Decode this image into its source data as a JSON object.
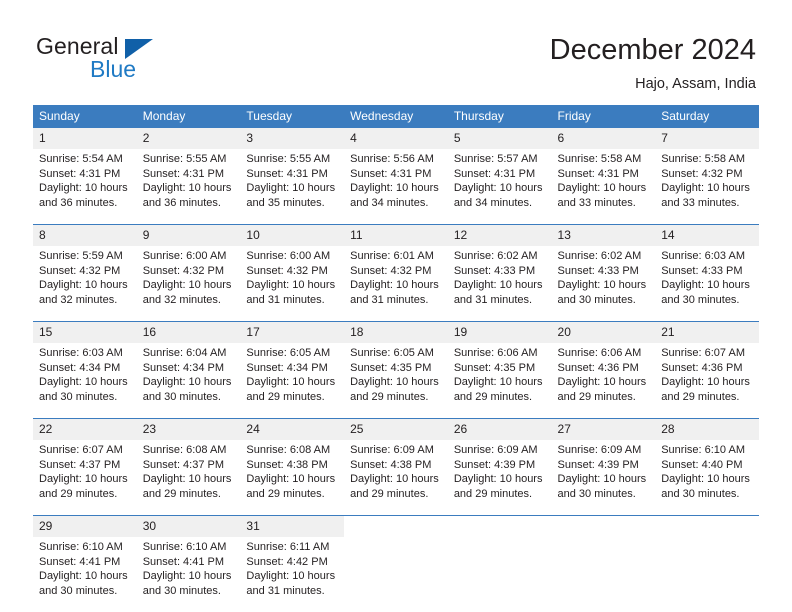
{
  "brand": {
    "name_part1": "General",
    "name_part2": "Blue",
    "triangle_icon": "triangle-icon",
    "accent_blue": "#1f7ac4",
    "logo_blue": "#1060a8"
  },
  "header": {
    "title": "December 2024",
    "subtitle": "Hajo, Assam, India"
  },
  "calendar": {
    "header_bg": "#3b7cbf",
    "header_text_color": "#ffffff",
    "daynum_bg": "#f0f0f0",
    "weekdays": [
      "Sunday",
      "Monday",
      "Tuesday",
      "Wednesday",
      "Thursday",
      "Friday",
      "Saturday"
    ],
    "labels": {
      "sunrise": "Sunrise:",
      "sunset": "Sunset:",
      "daylight": "Daylight:"
    },
    "weeks": [
      [
        {
          "day": "1",
          "sunrise": "Sunrise: 5:54 AM",
          "sunset": "Sunset: 4:31 PM",
          "daylight_a": "Daylight: 10 hours",
          "daylight_b": "and 36 minutes."
        },
        {
          "day": "2",
          "sunrise": "Sunrise: 5:55 AM",
          "sunset": "Sunset: 4:31 PM",
          "daylight_a": "Daylight: 10 hours",
          "daylight_b": "and 36 minutes."
        },
        {
          "day": "3",
          "sunrise": "Sunrise: 5:55 AM",
          "sunset": "Sunset: 4:31 PM",
          "daylight_a": "Daylight: 10 hours",
          "daylight_b": "and 35 minutes."
        },
        {
          "day": "4",
          "sunrise": "Sunrise: 5:56 AM",
          "sunset": "Sunset: 4:31 PM",
          "daylight_a": "Daylight: 10 hours",
          "daylight_b": "and 34 minutes."
        },
        {
          "day": "5",
          "sunrise": "Sunrise: 5:57 AM",
          "sunset": "Sunset: 4:31 PM",
          "daylight_a": "Daylight: 10 hours",
          "daylight_b": "and 34 minutes."
        },
        {
          "day": "6",
          "sunrise": "Sunrise: 5:58 AM",
          "sunset": "Sunset: 4:31 PM",
          "daylight_a": "Daylight: 10 hours",
          "daylight_b": "and 33 minutes."
        },
        {
          "day": "7",
          "sunrise": "Sunrise: 5:58 AM",
          "sunset": "Sunset: 4:32 PM",
          "daylight_a": "Daylight: 10 hours",
          "daylight_b": "and 33 minutes."
        }
      ],
      [
        {
          "day": "8",
          "sunrise": "Sunrise: 5:59 AM",
          "sunset": "Sunset: 4:32 PM",
          "daylight_a": "Daylight: 10 hours",
          "daylight_b": "and 32 minutes."
        },
        {
          "day": "9",
          "sunrise": "Sunrise: 6:00 AM",
          "sunset": "Sunset: 4:32 PM",
          "daylight_a": "Daylight: 10 hours",
          "daylight_b": "and 32 minutes."
        },
        {
          "day": "10",
          "sunrise": "Sunrise: 6:00 AM",
          "sunset": "Sunset: 4:32 PM",
          "daylight_a": "Daylight: 10 hours",
          "daylight_b": "and 31 minutes."
        },
        {
          "day": "11",
          "sunrise": "Sunrise: 6:01 AM",
          "sunset": "Sunset: 4:32 PM",
          "daylight_a": "Daylight: 10 hours",
          "daylight_b": "and 31 minutes."
        },
        {
          "day": "12",
          "sunrise": "Sunrise: 6:02 AM",
          "sunset": "Sunset: 4:33 PM",
          "daylight_a": "Daylight: 10 hours",
          "daylight_b": "and 31 minutes."
        },
        {
          "day": "13",
          "sunrise": "Sunrise: 6:02 AM",
          "sunset": "Sunset: 4:33 PM",
          "daylight_a": "Daylight: 10 hours",
          "daylight_b": "and 30 minutes."
        },
        {
          "day": "14",
          "sunrise": "Sunrise: 6:03 AM",
          "sunset": "Sunset: 4:33 PM",
          "daylight_a": "Daylight: 10 hours",
          "daylight_b": "and 30 minutes."
        }
      ],
      [
        {
          "day": "15",
          "sunrise": "Sunrise: 6:03 AM",
          "sunset": "Sunset: 4:34 PM",
          "daylight_a": "Daylight: 10 hours",
          "daylight_b": "and 30 minutes."
        },
        {
          "day": "16",
          "sunrise": "Sunrise: 6:04 AM",
          "sunset": "Sunset: 4:34 PM",
          "daylight_a": "Daylight: 10 hours",
          "daylight_b": "and 30 minutes."
        },
        {
          "day": "17",
          "sunrise": "Sunrise: 6:05 AM",
          "sunset": "Sunset: 4:34 PM",
          "daylight_a": "Daylight: 10 hours",
          "daylight_b": "and 29 minutes."
        },
        {
          "day": "18",
          "sunrise": "Sunrise: 6:05 AM",
          "sunset": "Sunset: 4:35 PM",
          "daylight_a": "Daylight: 10 hours",
          "daylight_b": "and 29 minutes."
        },
        {
          "day": "19",
          "sunrise": "Sunrise: 6:06 AM",
          "sunset": "Sunset: 4:35 PM",
          "daylight_a": "Daylight: 10 hours",
          "daylight_b": "and 29 minutes."
        },
        {
          "day": "20",
          "sunrise": "Sunrise: 6:06 AM",
          "sunset": "Sunset: 4:36 PM",
          "daylight_a": "Daylight: 10 hours",
          "daylight_b": "and 29 minutes."
        },
        {
          "day": "21",
          "sunrise": "Sunrise: 6:07 AM",
          "sunset": "Sunset: 4:36 PM",
          "daylight_a": "Daylight: 10 hours",
          "daylight_b": "and 29 minutes."
        }
      ],
      [
        {
          "day": "22",
          "sunrise": "Sunrise: 6:07 AM",
          "sunset": "Sunset: 4:37 PM",
          "daylight_a": "Daylight: 10 hours",
          "daylight_b": "and 29 minutes."
        },
        {
          "day": "23",
          "sunrise": "Sunrise: 6:08 AM",
          "sunset": "Sunset: 4:37 PM",
          "daylight_a": "Daylight: 10 hours",
          "daylight_b": "and 29 minutes."
        },
        {
          "day": "24",
          "sunrise": "Sunrise: 6:08 AM",
          "sunset": "Sunset: 4:38 PM",
          "daylight_a": "Daylight: 10 hours",
          "daylight_b": "and 29 minutes."
        },
        {
          "day": "25",
          "sunrise": "Sunrise: 6:09 AM",
          "sunset": "Sunset: 4:38 PM",
          "daylight_a": "Daylight: 10 hours",
          "daylight_b": "and 29 minutes."
        },
        {
          "day": "26",
          "sunrise": "Sunrise: 6:09 AM",
          "sunset": "Sunset: 4:39 PM",
          "daylight_a": "Daylight: 10 hours",
          "daylight_b": "and 29 minutes."
        },
        {
          "day": "27",
          "sunrise": "Sunrise: 6:09 AM",
          "sunset": "Sunset: 4:39 PM",
          "daylight_a": "Daylight: 10 hours",
          "daylight_b": "and 30 minutes."
        },
        {
          "day": "28",
          "sunrise": "Sunrise: 6:10 AM",
          "sunset": "Sunset: 4:40 PM",
          "daylight_a": "Daylight: 10 hours",
          "daylight_b": "and 30 minutes."
        }
      ],
      [
        {
          "day": "29",
          "sunrise": "Sunrise: 6:10 AM",
          "sunset": "Sunset: 4:41 PM",
          "daylight_a": "Daylight: 10 hours",
          "daylight_b": "and 30 minutes."
        },
        {
          "day": "30",
          "sunrise": "Sunrise: 6:10 AM",
          "sunset": "Sunset: 4:41 PM",
          "daylight_a": "Daylight: 10 hours",
          "daylight_b": "and 30 minutes."
        },
        {
          "day": "31",
          "sunrise": "Sunrise: 6:11 AM",
          "sunset": "Sunset: 4:42 PM",
          "daylight_a": "Daylight: 10 hours",
          "daylight_b": "and 31 minutes."
        },
        {
          "day": "",
          "sunrise": "",
          "sunset": "",
          "daylight_a": "",
          "daylight_b": ""
        },
        {
          "day": "",
          "sunrise": "",
          "sunset": "",
          "daylight_a": "",
          "daylight_b": ""
        },
        {
          "day": "",
          "sunrise": "",
          "sunset": "",
          "daylight_a": "",
          "daylight_b": ""
        },
        {
          "day": "",
          "sunrise": "",
          "sunset": "",
          "daylight_a": "",
          "daylight_b": ""
        }
      ]
    ]
  }
}
